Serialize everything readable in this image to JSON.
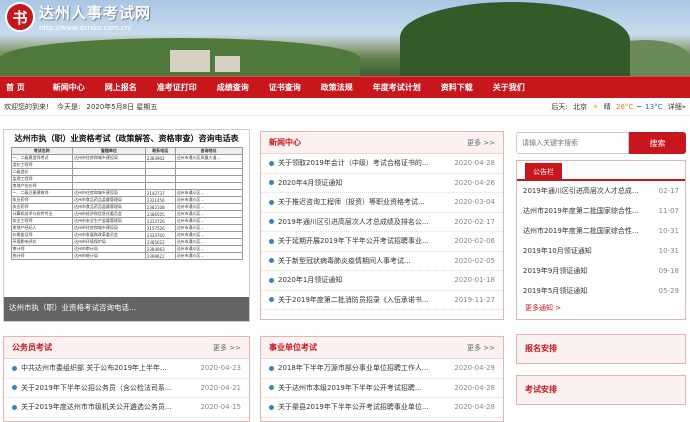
{
  "header": {
    "logo_char": "书",
    "title": "达州人事考试网",
    "url": "http://www.dzrsks.com.cn/"
  },
  "nav": [
    "首 页",
    "新闻中心",
    "网上报名",
    "准考证打印",
    "成绩查询",
    "证书查询",
    "政策法规",
    "年度考试计划",
    "资料下载",
    "关于我们"
  ],
  "infobar": {
    "welcome": "欢迎您的到来!",
    "today_label": "今天是:",
    "date": "2020年5月8日 星期五",
    "weather_label": "后天:",
    "city": "北京",
    "condition": "晴",
    "temp_high": "26°C",
    "sep": "~",
    "temp_low": "13°C",
    "detail": "详细»"
  },
  "doc": {
    "title": "达州市执（职）业资格考试（政策解答、资格审查）咨询电话表",
    "headers": [
      "考试名称",
      "管理单位",
      "联系电话",
      "咨询地址"
    ],
    "rows": [
      [
        "一、二级建造师考试",
        "达州市住房和城乡建设局",
        "2383902",
        "达州市通川区凤凰大道..."
      ],
      [
        "造价工程师",
        "",
        "",
        ""
      ],
      [
        "二级造价",
        "",
        "",
        ""
      ],
      [
        "监理工程师",
        "",
        "",
        ""
      ],
      [
        "房地产估价师",
        "",
        "",
        ""
      ],
      [
        "一、二级注册建筑师",
        "达州市住房和城乡建设局",
        "2142737",
        "达州市通川区..."
      ],
      [
        "执业药师",
        "达州市食品药品监督管理局",
        "2321456",
        "达州市通川区..."
      ],
      [
        "执业药师",
        "达州市食品药品监督管理局",
        "2382108",
        "达州市通川区..."
      ],
      [
        "计算机技术与软件专业",
        "达州市经济和信息化委员会",
        "2386505",
        "达州市通川区..."
      ],
      [
        "安全工程师",
        "达州市安全生产监督管理局",
        "2313726",
        "达州市通川区..."
      ],
      [
        "房地产经纪人",
        "达州市住房和城乡建设局",
        "2157526",
        "达州市通川区..."
      ],
      [
        "价格鉴证师",
        "达州市发展和改革委员会",
        "2333700",
        "达州市通川区..."
      ],
      [
        "环境影响评价",
        "达州市环境保护局",
        "2385622",
        "达州市通川区..."
      ],
      [
        "审计师",
        "达州市审计局",
        "2384063",
        "达州市通川区..."
      ],
      [
        "统计师",
        "达州市统计局",
        "2399622",
        "达州市通川区..."
      ]
    ],
    "caption": "达州市执（职）业资格考试咨询电话..."
  },
  "news": {
    "title": "新闻中心",
    "more": "更多 >>",
    "items": [
      {
        "text": "关于领取2019年会计（中级）考试合格证书的...",
        "date": "2020-04-28"
      },
      {
        "text": "2020年4月领证通知",
        "date": "2020-04-26"
      },
      {
        "text": "关于推迟咨询工程师（投资）等职业资格考试...",
        "date": "2020-03-04"
      },
      {
        "text": "2019年通川区引进高层次人才总成绩及排名公...",
        "date": "2020-02-17"
      },
      {
        "text": "关于延期开展2019年下半年公开考试招聘事业...",
        "date": "2020-02-06"
      },
      {
        "text": "关于新型冠状病毒肺炎疫情期间人事考试...",
        "date": "2020-02-05"
      },
      {
        "text": "2020年1月领证通知",
        "date": "2020-01-18"
      },
      {
        "text": "关于2019年度第二批消防员招录《入伍承诺书...",
        "date": "2019-11-27"
      }
    ]
  },
  "search": {
    "placeholder": "请输入关键字搜索",
    "button": "搜索"
  },
  "notice": {
    "tab": "公告栏",
    "items": [
      {
        "text": "2019年通川区引进高层次人才总成...",
        "date": "02-17"
      },
      {
        "text": "达州市2019年度第二批国家综合性...",
        "date": "11-07"
      },
      {
        "text": "达州市2019年度第二批国家综合性...",
        "date": "10-31"
      },
      {
        "text": "2019年10月领证通知",
        "date": "10-31"
      },
      {
        "text": "2019年9月领证通知",
        "date": "09-18"
      },
      {
        "text": "2019年5月领证通知",
        "date": "05-29"
      }
    ],
    "more": "更多通知 >"
  },
  "civil": {
    "title": "公务员考试",
    "more": "更多 >>",
    "items": [
      {
        "text": "中共达州市委组织部 关于公布2019年上半年...",
        "date": "2020-04-23"
      },
      {
        "text": "关于2019年下半年公招公务员（含公检法司系...",
        "date": "2020-04-21"
      },
      {
        "text": "关于2019年度达州市市级机关公开遴选公务员...",
        "date": "2020-04-15"
      }
    ]
  },
  "public": {
    "title": "事业单位考试",
    "more": "更多 >>",
    "items": [
      {
        "text": "2018年下半年万源市部分事业单位招聘工作人...",
        "date": "2020-04-29"
      },
      {
        "text": "关于达州市本级2019年下半年公开考试招聘...",
        "date": "2020-04-28"
      },
      {
        "text": "关于渠县2019年下半年公开考试招聘事业单位...",
        "date": "2020-04-28"
      }
    ]
  },
  "signup": {
    "title": "报名安排"
  },
  "exam": {
    "title": "考试安排"
  }
}
